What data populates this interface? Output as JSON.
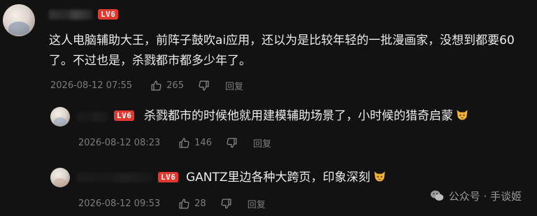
{
  "comments": [
    {
      "level": "LV6",
      "text_line1": "这人电脑辅助大王，前阵子鼓吹ai应用，还以为是比较年轻的一批漫画家，没想到都要60",
      "text_line2": "了。不过也是，杀戮都市都多少年了。",
      "date": "2026-08-12 07:55",
      "likes": "265",
      "reply_label": "回复"
    },
    {
      "level": "LV6",
      "text": "杀戮都市的时候他就用建模辅助场景了，小时候的猎奇启蒙",
      "emoji": "cat-emoji",
      "date": "2026-08-12 08:23",
      "likes": "146",
      "reply_label": "回复"
    },
    {
      "level": "LV6",
      "text": "GANTZ里边各种大跨页，印象深刻",
      "emoji": "cat-emoji",
      "date": "2026-08-12 09:53",
      "likes": "28",
      "reply_label": "回复"
    }
  ],
  "watermark": {
    "text": "公众号 · 手谈姬",
    "icon": "wechat-icon"
  },
  "colors": {
    "background": "#121212",
    "level_badge": "#e0392f",
    "meta_text": "#7d7d7d"
  }
}
